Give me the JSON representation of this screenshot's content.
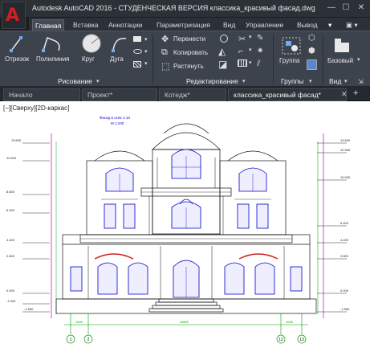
{
  "window": {
    "title": "Autodesk AutoCAD 2016 - СТУДЕНЧЕСКАЯ ВЕРСИЯ   классика_красивый фасад.dwg",
    "logo": "A"
  },
  "ribbon_tabs": [
    "Главная",
    "Вставка",
    "Аннотации",
    "Параметризация",
    "Вид",
    "Управление",
    "Вывод"
  ],
  "draw_group": {
    "title": "Рисование",
    "tools": [
      "Отрезок",
      "Полилиния",
      "Круг",
      "Дуга"
    ]
  },
  "modify_group": {
    "title": "Редактирование",
    "tools": [
      "Перенести",
      "Копировать",
      "Растянуть"
    ]
  },
  "groups_group": {
    "title": "Группы",
    "tool": "Группа"
  },
  "view_group": {
    "title": "Вид",
    "tool": "Базовый"
  },
  "doc_tabs": [
    "Начало",
    "Проект*",
    "Котедж*",
    "классика_красивый фасад*"
  ],
  "new_tab_symbol": "+",
  "viewport_label": "[−][Сверху][2D-каркас]",
  "drawing": {
    "caption_line1": "Фасад в осях 1-13",
    "caption_line2": "М 1:100",
    "levels_left": [
      "13.600",
      "11.620",
      "8.600",
      "6.200",
      "4.400",
      "2.800",
      "0.000",
      "-1.020",
      "-1.550"
    ],
    "levels_right": [
      "13.600",
      "12.900",
      "10.000",
      "6.400",
      "4.400",
      "2.800",
      "0.000",
      "-1.550"
    ],
    "axes": [
      "1",
      "2",
      "12",
      "13"
    ],
    "dims_bottom": [
      "1000",
      "11500",
      "1000"
    ]
  },
  "colors": {
    "accent_red": "#d02020",
    "cad_green": "#00a000",
    "cad_blue": "#0000cc",
    "cad_magenta": "#c000c0"
  }
}
